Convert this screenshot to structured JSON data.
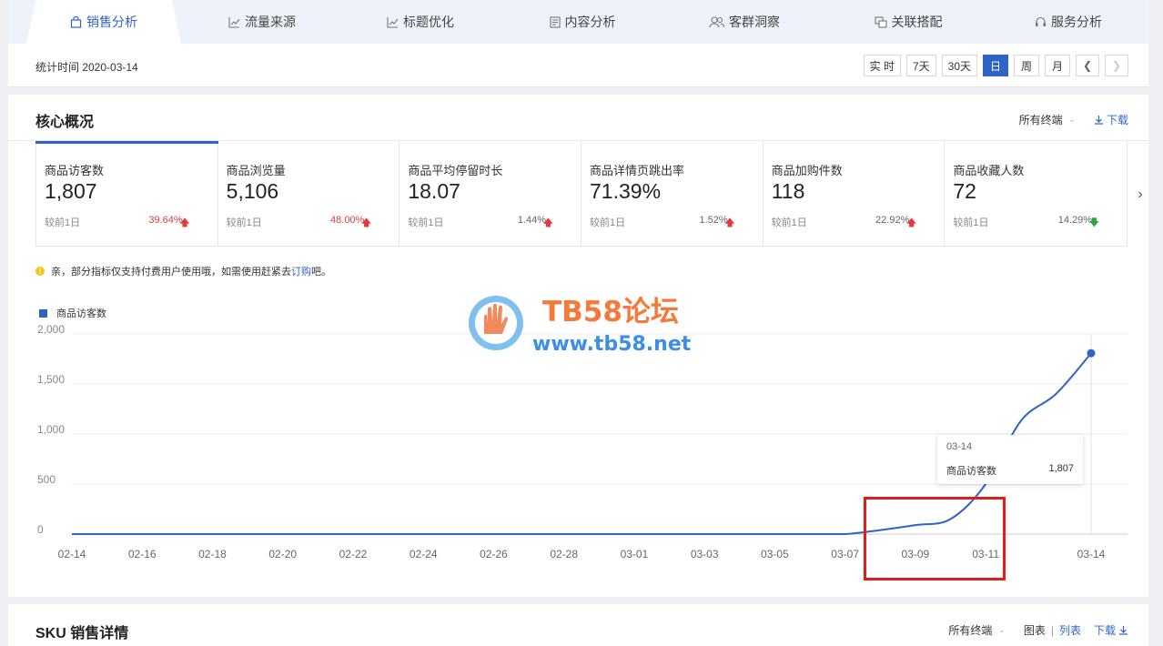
{
  "tabs": [
    {
      "label": "销售分析",
      "icon": "bag-icon"
    },
    {
      "label": "流量来源",
      "icon": "trend-icon"
    },
    {
      "label": "标题优化",
      "icon": "trend-icon"
    },
    {
      "label": "内容分析",
      "icon": "document-icon"
    },
    {
      "label": "客群洞察",
      "icon": "users-icon"
    },
    {
      "label": "关联搭配",
      "icon": "link-icon"
    },
    {
      "label": "服务分析",
      "icon": "headset-icon"
    }
  ],
  "stat_time": "统计时间 2020-03-14",
  "periods": {
    "realtime": "实 时",
    "d7": "7天",
    "d30": "30天",
    "day": "日",
    "week": "周",
    "month": "月",
    "active": "日"
  },
  "overview": {
    "title": "核心概况",
    "terminal": "所有终端",
    "download": "下载",
    "metrics": [
      {
        "label": "商品访客数",
        "value": "1,807",
        "compare": "较前1日",
        "pct": "39.64%",
        "dir": "up"
      },
      {
        "label": "商品浏览量",
        "value": "5,106",
        "compare": "较前1日",
        "pct": "48.00%",
        "dir": "up"
      },
      {
        "label": "商品平均停留时长",
        "value": "18.07",
        "compare": "较前1日",
        "pct": "1.44%",
        "dir": "up"
      },
      {
        "label": "商品详情页跳出率",
        "value": "71.39%",
        "compare": "较前1日",
        "pct": "1.52%",
        "dir": "up"
      },
      {
        "label": "商品加购件数",
        "value": "118",
        "compare": "较前1日",
        "pct": "22.92%",
        "dir": "up"
      },
      {
        "label": "商品收藏人数",
        "value": "72",
        "compare": "较前1日",
        "pct": "14.29%",
        "dir": "down"
      }
    ],
    "notice_before": "亲，部分指标仅支持付费用户使用哦，如需使用赶紧去 ",
    "notice_link": "订购",
    "notice_after": "吧。"
  },
  "watermark": {
    "line1": "TB58论坛",
    "line2": "www.tb58.net"
  },
  "chart_data": {
    "type": "line",
    "series": [
      {
        "name": "商品访客数",
        "x": [
          "02-14",
          "02-15",
          "02-16",
          "02-17",
          "02-18",
          "02-19",
          "02-20",
          "02-21",
          "02-22",
          "02-23",
          "02-24",
          "02-25",
          "02-26",
          "02-27",
          "02-28",
          "02-29",
          "03-01",
          "03-02",
          "03-03",
          "03-04",
          "03-05",
          "03-06",
          "03-07",
          "03-08",
          "03-09",
          "03-10",
          "03-11",
          "03-12",
          "03-13",
          "03-14"
        ],
        "values": [
          0,
          0,
          0,
          0,
          0,
          0,
          0,
          0,
          0,
          0,
          0,
          0,
          0,
          0,
          0,
          0,
          0,
          0,
          0,
          0,
          0,
          0,
          0,
          40,
          90,
          150,
          500,
          1130,
          1400,
          1807
        ],
        "color": "#2e65c4"
      }
    ],
    "x_ticks": [
      "02-14",
      "02-16",
      "02-18",
      "02-20",
      "02-22",
      "02-24",
      "02-26",
      "02-28",
      "03-01",
      "03-03",
      "03-05",
      "03-07",
      "03-09",
      "03-11",
      "03-14"
    ],
    "y_ticks": [
      "2,000",
      "1,500",
      "1,000",
      "500",
      "0"
    ],
    "ylim": [
      0,
      2000
    ],
    "grid": true,
    "legend": "top-left",
    "tooltip": {
      "date": "03-14",
      "name": "商品访客数",
      "value": "1,807"
    }
  },
  "sku": {
    "title": "SKU 销售详情",
    "terminal": "所有终端",
    "chart": "图表",
    "sep": "|",
    "list": "列表",
    "download": "下载"
  }
}
